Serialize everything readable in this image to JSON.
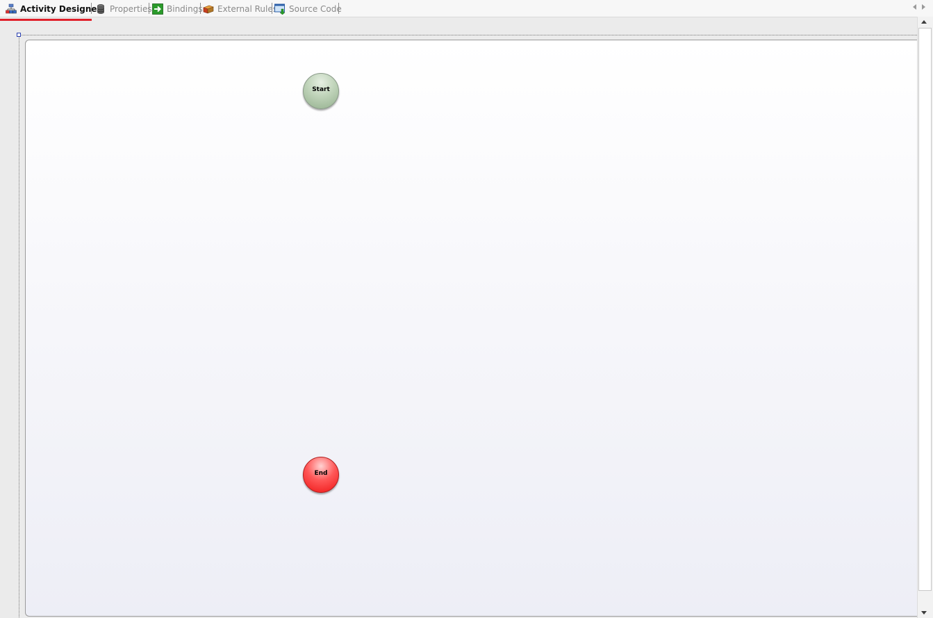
{
  "tabs": [
    {
      "label": "Activity Designer",
      "icon": "activity-designer-icon",
      "active": true
    },
    {
      "label": "Properties",
      "icon": "properties-icon",
      "active": false
    },
    {
      "label": "Bindings",
      "icon": "bindings-icon",
      "active": false
    },
    {
      "label": "External Rules",
      "icon": "external-rules-icon",
      "active": false
    },
    {
      "label": "Source Code",
      "icon": "source-code-icon",
      "active": false
    }
  ],
  "designer": {
    "nodes": {
      "start": {
        "label": "Start",
        "color": "#a7c2a1"
      },
      "end": {
        "label": "End",
        "color": "#ff2a2a"
      }
    }
  },
  "colors": {
    "active_tab_underline": "#e0202a",
    "inactive_tab_text": "#8a8a8a"
  }
}
